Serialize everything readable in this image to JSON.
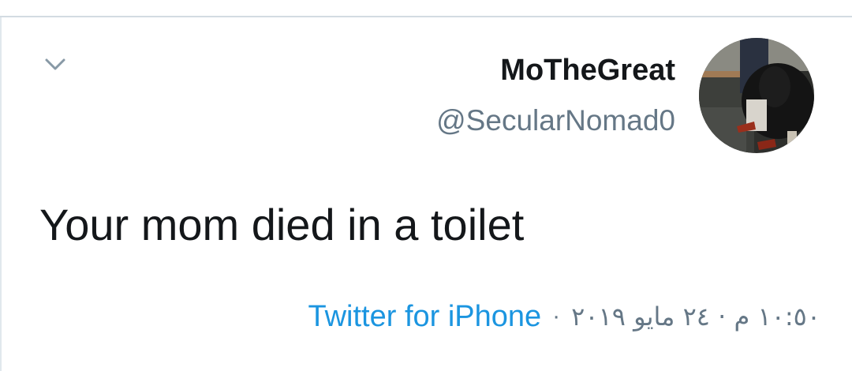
{
  "tweet": {
    "author": {
      "display_name": "MoTheGreat",
      "handle": "@SecularNomad0"
    },
    "text": "Your mom died in a toilet",
    "source": "Twitter for iPhone",
    "separator": "·",
    "timestamp": "١٠:٥٠ م · ٢٤ مايو ٢٠١٩"
  },
  "icons": {
    "menu": "chevron-down-icon"
  },
  "colors": {
    "name": "#14171a",
    "secondary": "#657786",
    "link": "#1b95e0",
    "divider": "#d3dbe2"
  }
}
